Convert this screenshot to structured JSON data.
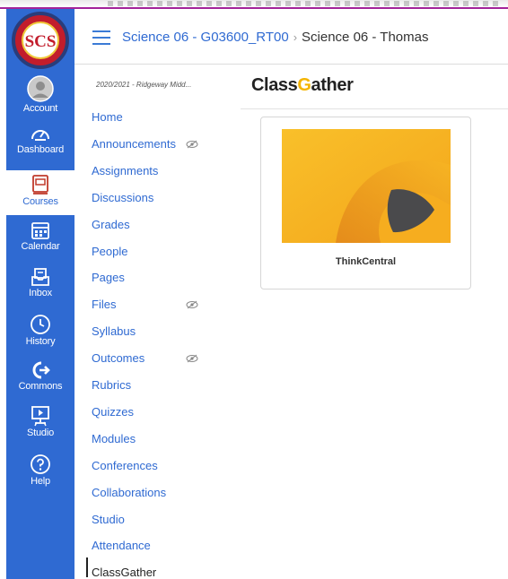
{
  "global_nav": {
    "logo_text": "SCS",
    "items": [
      {
        "label": "Account",
        "icon": "account-avatar-icon"
      },
      {
        "label": "Dashboard",
        "icon": "dashboard-icon"
      },
      {
        "label": "Courses",
        "icon": "courses-icon",
        "active": true
      },
      {
        "label": "Calendar",
        "icon": "calendar-icon"
      },
      {
        "label": "Inbox",
        "icon": "inbox-icon"
      },
      {
        "label": "History",
        "icon": "history-icon"
      },
      {
        "label": "Commons",
        "icon": "commons-icon"
      },
      {
        "label": "Studio",
        "icon": "studio-icon"
      },
      {
        "label": "Help",
        "icon": "help-icon"
      }
    ]
  },
  "breadcrumb": {
    "course": "Science 06 - G03600_RT00",
    "separator": "›",
    "current": "Science 06 - Thomas"
  },
  "course_nav": {
    "term": "2020/2021 - Ridgeway Midd...",
    "items": [
      {
        "label": "Home"
      },
      {
        "label": "Announcements",
        "hidden": true
      },
      {
        "label": "Assignments"
      },
      {
        "label": "Discussions"
      },
      {
        "label": "Grades"
      },
      {
        "label": "People"
      },
      {
        "label": "Pages"
      },
      {
        "label": "Files",
        "hidden": true
      },
      {
        "label": "Syllabus"
      },
      {
        "label": "Outcomes",
        "hidden": true
      },
      {
        "label": "Rubrics"
      },
      {
        "label": "Quizzes"
      },
      {
        "label": "Modules"
      },
      {
        "label": "Conferences"
      },
      {
        "label": "Collaborations"
      },
      {
        "label": "Studio"
      },
      {
        "label": "Attendance"
      },
      {
        "label": "ClassGather",
        "active": true
      }
    ]
  },
  "classgather": {
    "logo_part1": "Class",
    "logo_g": "G",
    "logo_part2": "ather",
    "card_title": "ThinkCentral"
  },
  "colors": {
    "nav_blue": "#2f6ad2",
    "card_yellow": "#f7b21f"
  }
}
